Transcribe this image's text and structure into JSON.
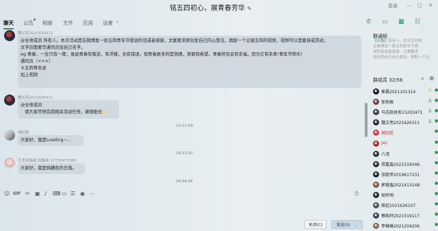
{
  "window": {
    "title": "铭五四初心，展青春芳华",
    "ctl_menu": "≡",
    "ctl_min": "—",
    "ctl_max": "□",
    "ctl_close": "✕",
    "ctl_pin": "菜单",
    "edit_icon": "✎"
  },
  "tabs": [
    {
      "label": "聊天"
    },
    {
      "label": "公告",
      "dot": true
    },
    {
      "label": "相册"
    },
    {
      "label": "文件"
    },
    {
      "label": "应用"
    },
    {
      "label": "设置",
      "caret": "⌄"
    }
  ],
  "messages": [
    {
      "sender": "魏文亮2021626311",
      "lines": [
        "@全体成员 所有人。本次活动是在微博发一段五四青年节想说的话或者感谢，文案要求原创发自己内心想法，再配一个记录五四的视频，视频可以是健身或劳动，",
        "文字后面要写通讯员加自己名字。",
        "eg:青春，一生只有一度，虽说青春有叛逆，有浮躁，也有错误，但青春更多的是热情，美丽和希望。青春终究会有幸福，因为它有未来!青年节快乐!",
        "通讯员（×××）",
        "＃五四青年说",
        "加上视频"
      ]
    },
    {
      "sender": "魏文亮2021626311",
      "lines": [
        "@全体成员",
        "请大家尽快完成相关活动任务，谢谢配合"
      ]
    },
    {
      "time": "15:11:59"
    },
    {
      "sender": "胡纪航",
      "lines": [
        "大家好，我是Loading~..."
      ]
    },
    {
      "time": "16:13:20"
    },
    {
      "sender": "艺术实践部 田雅菲 17735472560",
      "lines": [
        "大家好，我是纯橘色的日落。"
      ]
    },
    {
      "time": "16:44:36"
    }
  ],
  "toolbar": [
    "☺",
    "GIF",
    "✂",
    "▣",
    "♪",
    "⌨",
    "▭",
    "☰",
    "◉",
    "⋯",
    "⏱"
  ],
  "buttons": {
    "close": "关闭(C)",
    "send": "发送(S)"
  },
  "group": {
    "notice_title": "群通知",
    "notice_tag": "【公告】",
    "notice_lines": [
      "所有人。本次活动是",
      "在微博发一段五四青年节想",
      "说的话或者感谢，文案要求",
      "原创发自己内心想法，再配一个记"
    ],
    "members_label": "群成员 32/56",
    "search_icon": "⌕",
    "add_icon": "⊕"
  },
  "members": [
    {
      "name": "崔晨2021101314",
      "badge": "crown",
      "color": "#222"
    },
    {
      "name": "徐热根",
      "badge": "admin",
      "color": "#222"
    },
    {
      "name": "马志凯财务15203471",
      "badge": "admin",
      "color": "#222"
    },
    {
      "name": "魏文亮2021626311",
      "badge": "admin",
      "color": "#222"
    },
    {
      "name": "胡纪航",
      "badge": "",
      "color": "#d6332c"
    },
    {
      "name": "Jay",
      "badge": "",
      "color": "#d6332c"
    },
    {
      "name": "八湾",
      "badge": "",
      "color": "#222"
    },
    {
      "name": "郑嘉鑫2021519346",
      "badge": "",
      "color": "#222"
    },
    {
      "name": "张歆萍2019617231",
      "badge": "",
      "color": "#222"
    },
    {
      "name": "郭睿鑫2021413148",
      "badge": "",
      "color": "#222"
    },
    {
      "name": "胡世明",
      "badge": "",
      "color": "#222"
    },
    {
      "name": "席廷2021626107",
      "badge": "",
      "color": "#222"
    },
    {
      "name": "蔡皓轩2021519117",
      "badge": "",
      "color": "#222"
    },
    {
      "name": "李琳琳2021204206",
      "badge": "",
      "color": "#222"
    }
  ],
  "top_icons": [
    "✆",
    "▭",
    "▦",
    "☷"
  ],
  "colors": {
    "accent": "#2e8b57",
    "bubble": "#ced7dd",
    "send": "#c9dbe7",
    "red_name": "#d6332c"
  }
}
